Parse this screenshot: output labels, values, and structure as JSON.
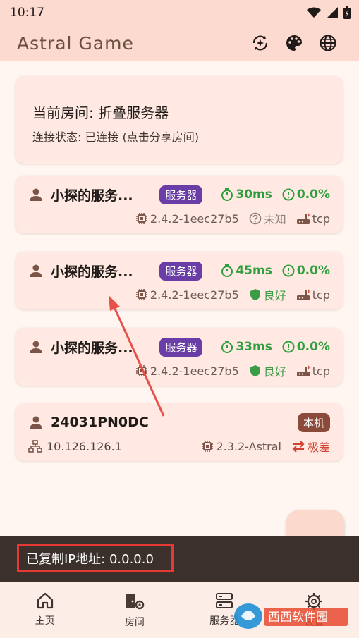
{
  "status_bar": {
    "time": "10:17"
  },
  "app": {
    "title": "Astral Game"
  },
  "room": {
    "title": "当前房间: 折叠服务器",
    "status": "连接状态: 已连接 (点击分享房间)"
  },
  "peers": [
    {
      "name": "小探的服务...",
      "badge": "服务器",
      "latency": "30ms",
      "loss": "0.0%",
      "version": "2.4.2-1eec27b5",
      "quality": "未知",
      "protocol": "tcp"
    },
    {
      "name": "小探的服务...",
      "badge": "服务器",
      "latency": "45ms",
      "loss": "0.0%",
      "version": "2.4.2-1eec27b5",
      "quality": "良好",
      "protocol": "tcp"
    },
    {
      "name": "小探的服务...",
      "badge": "服务器",
      "latency": "33ms",
      "loss": "0.0%",
      "version": "2.4.2-1eec27b5",
      "quality": "良好",
      "protocol": "tcp"
    }
  ],
  "local": {
    "name": "24031PN0DC",
    "badge": "本机",
    "ip": "10.126.126.1",
    "version": "2.3.2-Astral",
    "quality": "极差"
  },
  "snackbar": {
    "text": "已复制IP地址: 0.0.0.0"
  },
  "nav": [
    {
      "label": "主页",
      "icon": "home-icon"
    },
    {
      "label": "房间",
      "icon": "room-settings-icon"
    },
    {
      "label": "服务器",
      "icon": "server-icon"
    },
    {
      "label": "设置",
      "icon": "gear-icon"
    }
  ],
  "colors": {
    "accent_green": "#2e9e3e",
    "server_badge": "#6a3ea6",
    "local_badge": "#8b4a3a",
    "bad": "#d14232",
    "app_bar": "#fcdacf"
  },
  "watermark": {
    "text": "西西软件园"
  }
}
